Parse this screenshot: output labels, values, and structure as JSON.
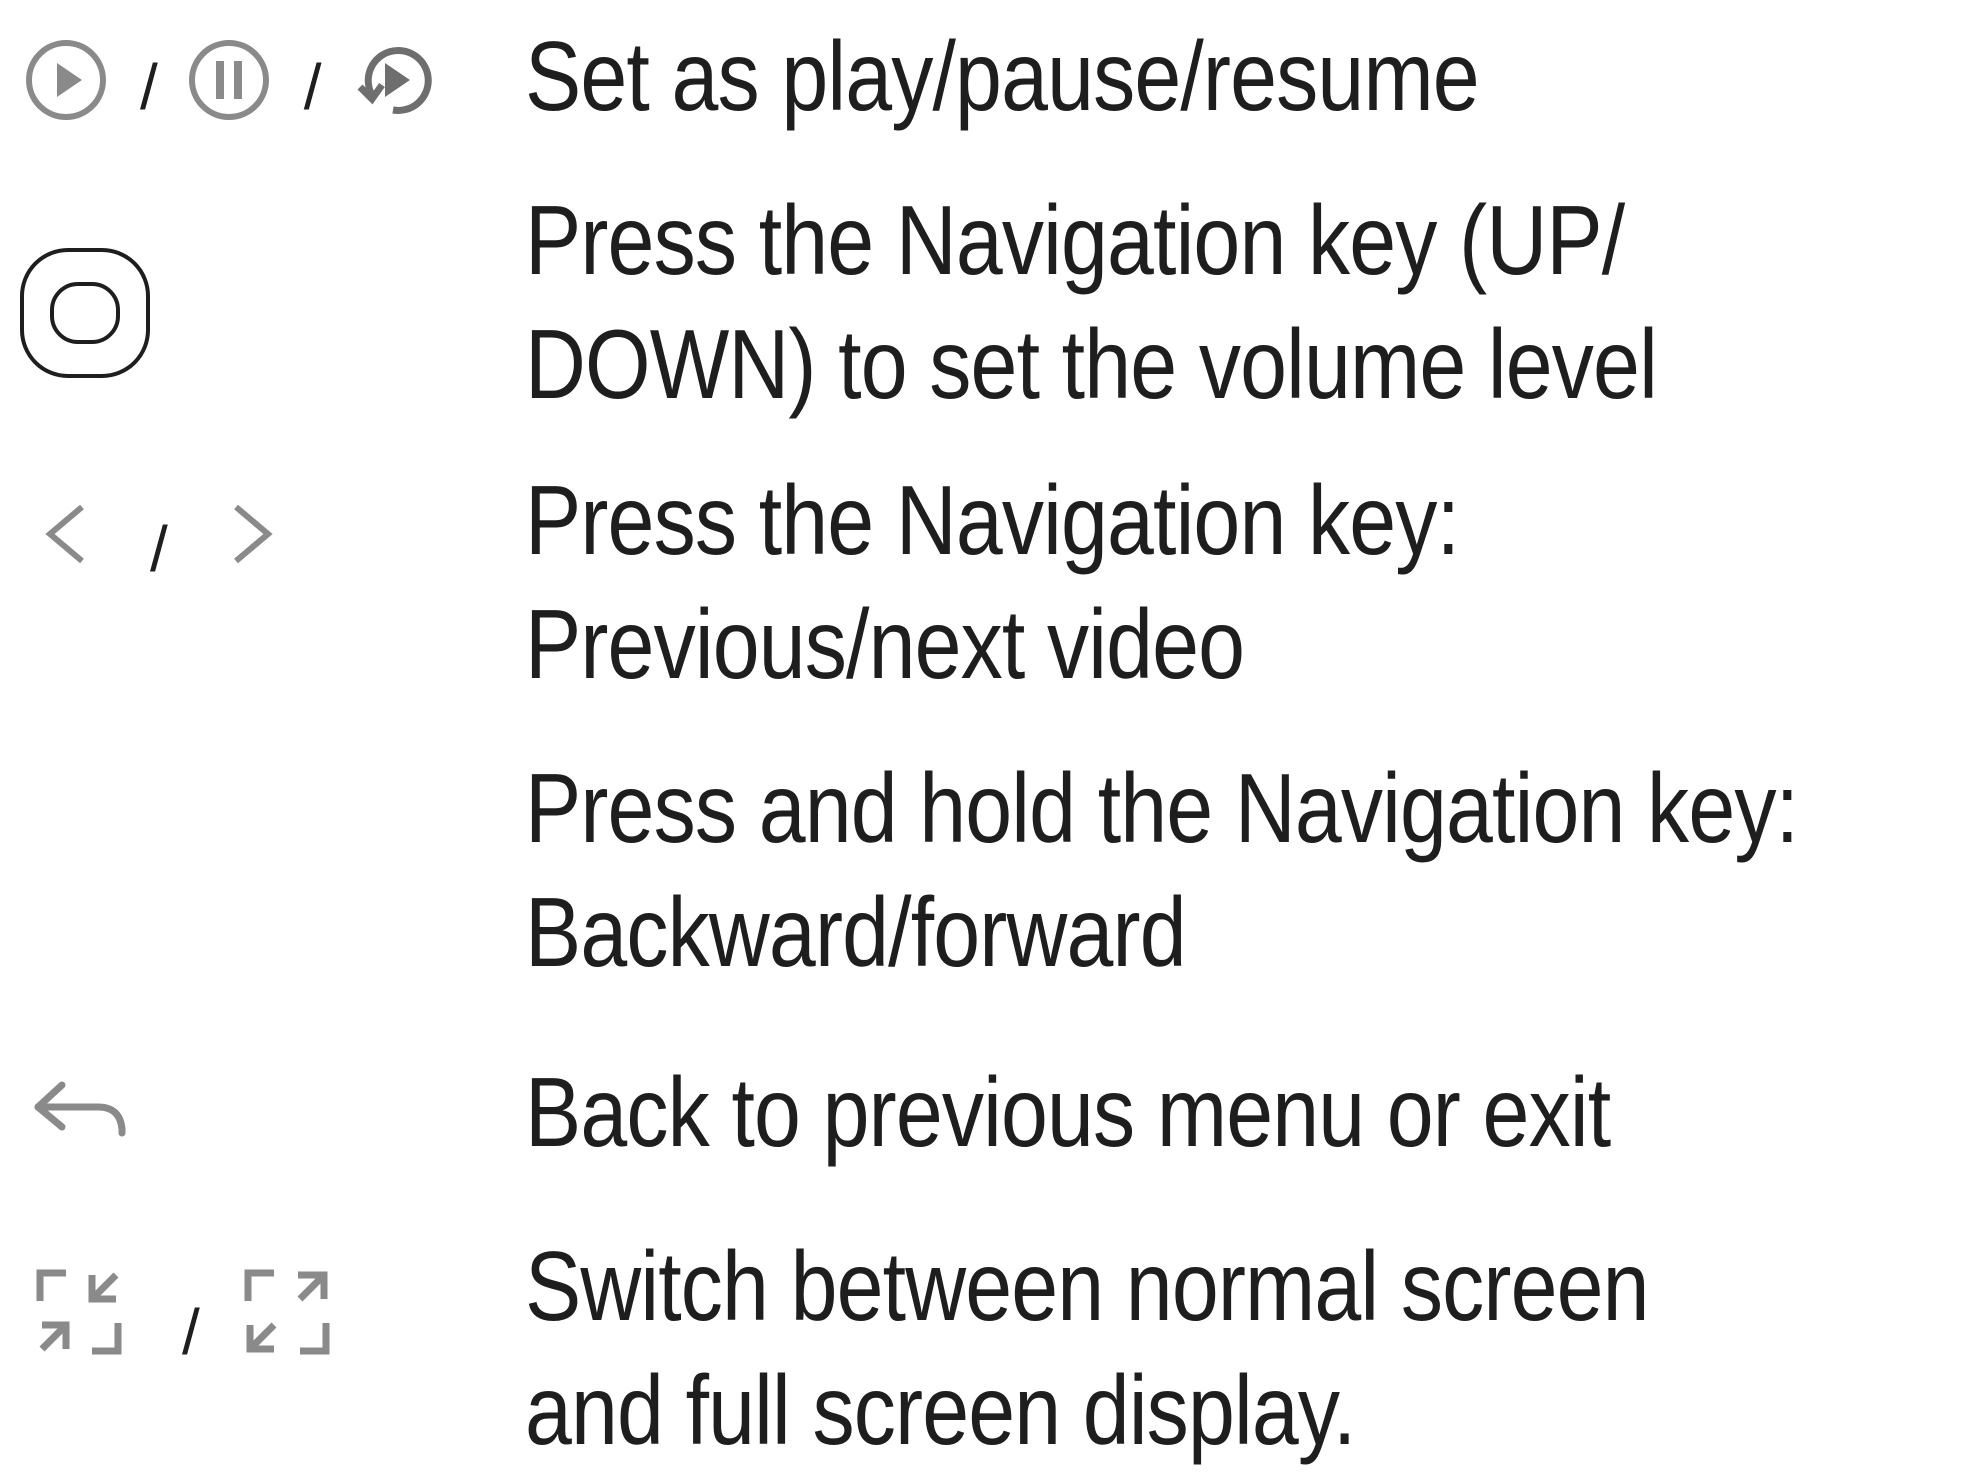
{
  "rows": [
    {
      "icons": [
        "play-circle-icon",
        "pause-circle-icon",
        "resume-circle-icon"
      ],
      "separator": "/",
      "lines": [
        "Set as play/pause/resume"
      ]
    },
    {
      "icons": [
        "navigation-key-icon"
      ],
      "lines": [
        "Press the Navigation key (UP/",
        "DOWN) to set the volume level"
      ]
    },
    {
      "icons": [
        "chevron-left-icon",
        "chevron-right-icon"
      ],
      "separator": "/",
      "lines": [
        "Press the Navigation key:",
        "Previous/next video"
      ]
    },
    {
      "icons": [],
      "lines": [
        "Press and hold the Navigation key:",
        "Backward/forward"
      ]
    },
    {
      "icons": [
        "back-arrow-icon"
      ],
      "lines": [
        "Back to previous menu or exit"
      ]
    },
    {
      "icons": [
        "exit-fullscreen-icon",
        "enter-fullscreen-icon"
      ],
      "separator": "/",
      "lines": [
        "Switch between normal screen",
        "and full screen display."
      ]
    }
  ],
  "colors": {
    "text": "#1e1e1e",
    "icon": "#8a8a8a",
    "icon_dark": "#2a2a2a"
  }
}
